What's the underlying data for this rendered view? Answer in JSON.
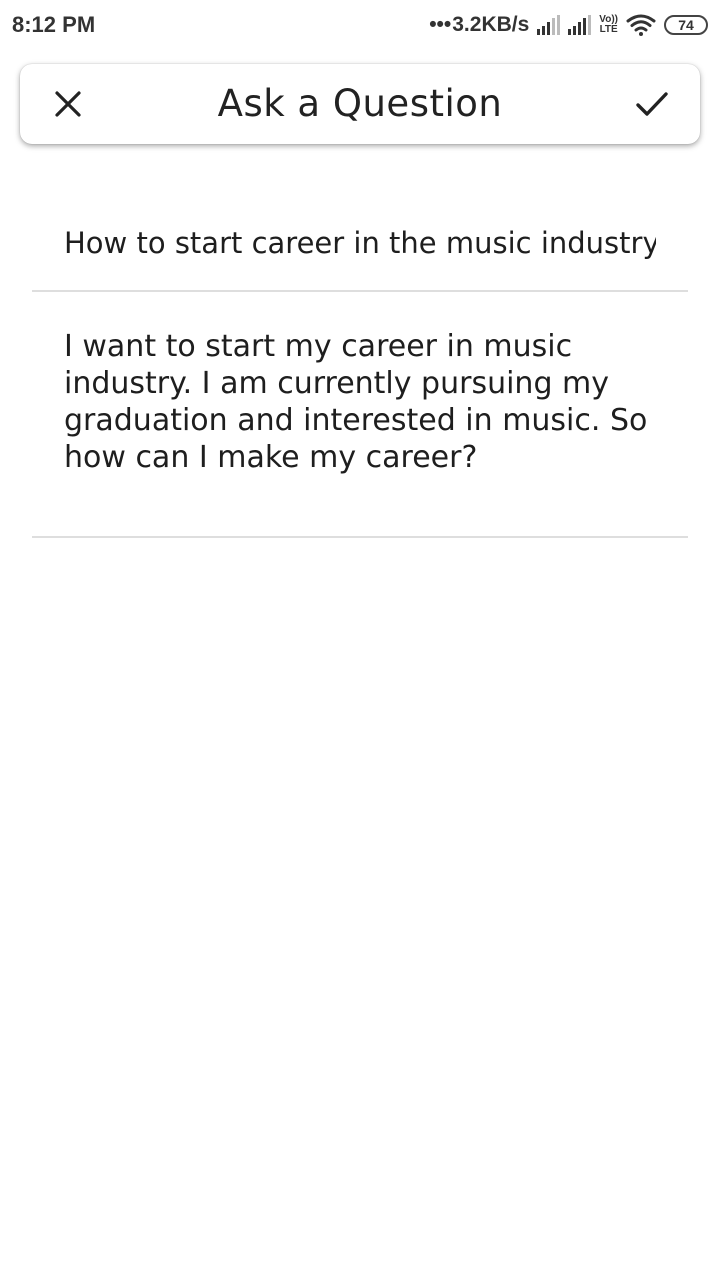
{
  "status_bar": {
    "time": "8:12 PM",
    "net_speed": "3.2KB/s",
    "net_dots": "•••",
    "volte_top": "Vo))",
    "volte_bottom": "LTE",
    "battery": "74"
  },
  "toolbar": {
    "title": "Ask a Question",
    "close_icon": "close-icon",
    "confirm_icon": "check-icon"
  },
  "form": {
    "question_title": "How to start career in the music industry",
    "question_body": "I want to start my career in music industry. I am currently pursuing my graduation and interested in music. So how can I make my career?"
  }
}
